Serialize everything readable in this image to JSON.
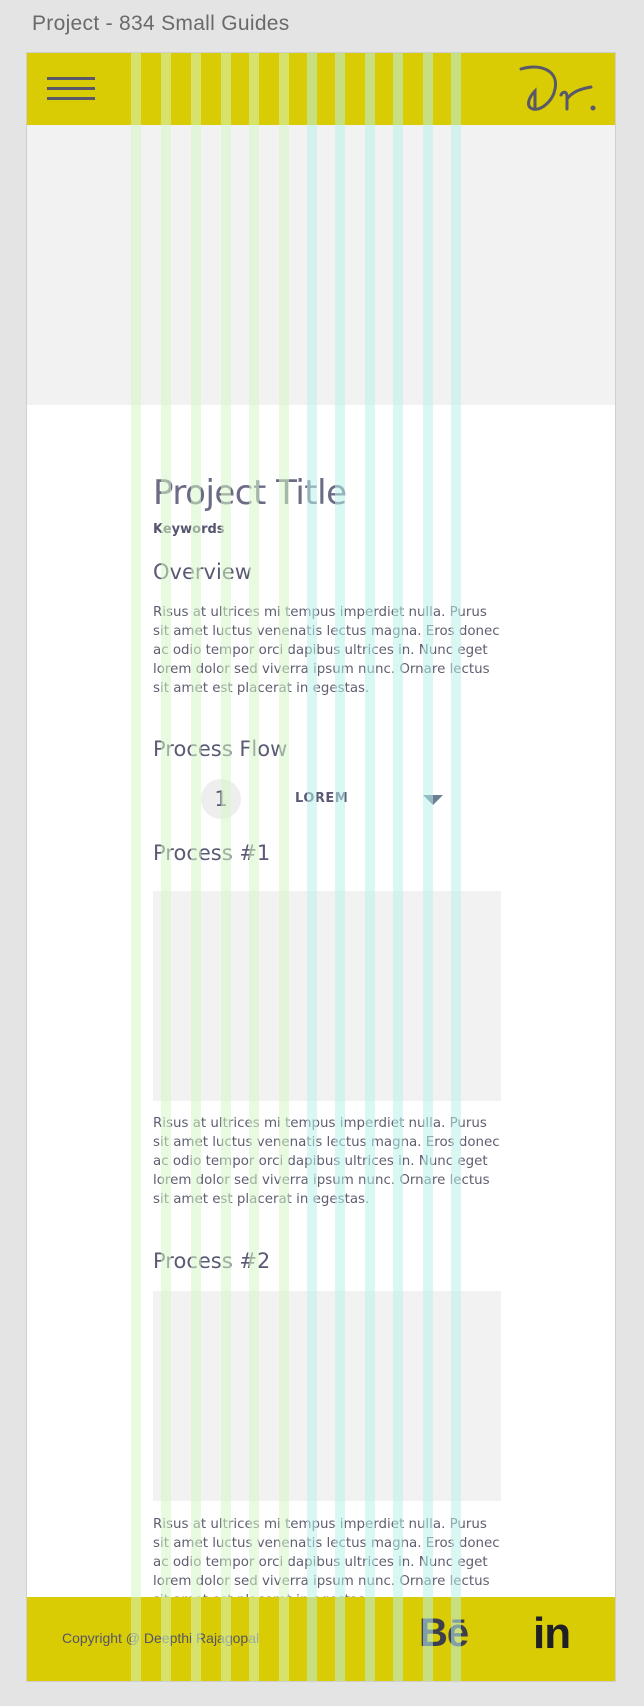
{
  "artboard": {
    "name": "Project - 834 Small Guides"
  },
  "header": {
    "menu_icon": "hamburger-menu-icon",
    "logo_icon": "signature-logo-icon",
    "accent_color": "#d9cb04"
  },
  "project": {
    "title": "Project Title",
    "keywords": "Keywords",
    "overview": {
      "heading": "Overview",
      "text": "Risus at ultrices mi tempus imperdiet nulla. Purus sit amet luctus venenatis lectus magna. Eros donec ac odio tempor orci dapibus ultrices in. Nunc eget lorem dolor sed viverra ipsum nunc. Ornare lectus sit amet est placerat in egestas."
    },
    "process_flow": {
      "heading": "Process Flow",
      "step_number": "1",
      "step_label": "LOREM",
      "dropdown_icon": "caret-down-icon"
    },
    "processes": [
      {
        "heading": "Process #1",
        "text": "Risus at ultrices mi tempus imperdiet nulla. Purus sit amet luctus venenatis lectus magna. Eros donec ac odio tempor orci dapibus ultrices in. Nunc eget lorem dolor sed viverra ipsum nunc. Ornare lectus sit amet est placerat in egestas."
      },
      {
        "heading": "Process #2",
        "text": "Risus at ultrices mi tempus imperdiet nulla. Purus sit amet luctus venenatis lectus magna. Eros donec ac odio tempor orci dapibus ultrices in. Nunc eget lorem dolor sed viverra ipsum nunc. Ornare lectus sit amet est placerat in egestas."
      }
    ]
  },
  "footer": {
    "copyright": "Copyright @ Deepthi Rajagopal",
    "behance_label": "Bē",
    "linkedin_label": "in"
  },
  "layout_grid": {
    "columns": 12,
    "column_color": "#baf0ea",
    "gutter_color": "#d6f6c4"
  }
}
